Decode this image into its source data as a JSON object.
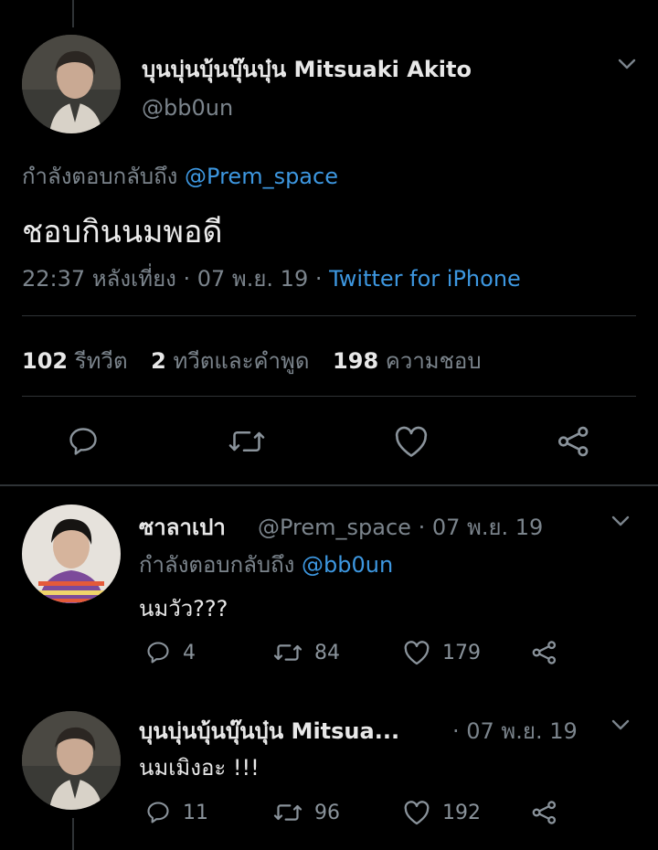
{
  "main_tweet": {
    "display_name": "บุนบุ่นบุ้นบุ๊นบุ๋น Mitsuaki Akito",
    "handle": "@bb0un",
    "replying_prefix": "กำลังตอบกลับถึง",
    "replying_to": "@Prem_space",
    "text": "ชอบกินนมพอดี",
    "timestamp": "22:37 หลังเที่ยง · 07 พ.ย. 19 · ",
    "source": "Twitter for iPhone",
    "stats": {
      "retweets_count": "102",
      "retweets_label": "รีทวีต",
      "quotes_count": "2",
      "quotes_label": "ทวีตและคำพูด",
      "likes_count": "198",
      "likes_label": "ความชอบ"
    }
  },
  "replies": [
    {
      "display_name": "ซาลาเปา",
      "handle_date": "@Prem_space · 07 พ.ย. 19",
      "replying_prefix": "กำลังตอบกลับถึง",
      "replying_to": "@bb0un",
      "text": "นมวัว???",
      "reply_count": "4",
      "retweet_count": "84",
      "like_count": "179"
    },
    {
      "display_name": "บุนบุ่นบุ้นบุ๊นบุ๋น Mitsua...",
      "date": "· 07 พ.ย. 19",
      "text": "นมเมิงอะ !!!",
      "reply_count": "11",
      "retweet_count": "96",
      "like_count": "192"
    }
  ],
  "colors": {
    "link": "#3d97e0",
    "muted": "#7b848c",
    "background": "#000000"
  }
}
